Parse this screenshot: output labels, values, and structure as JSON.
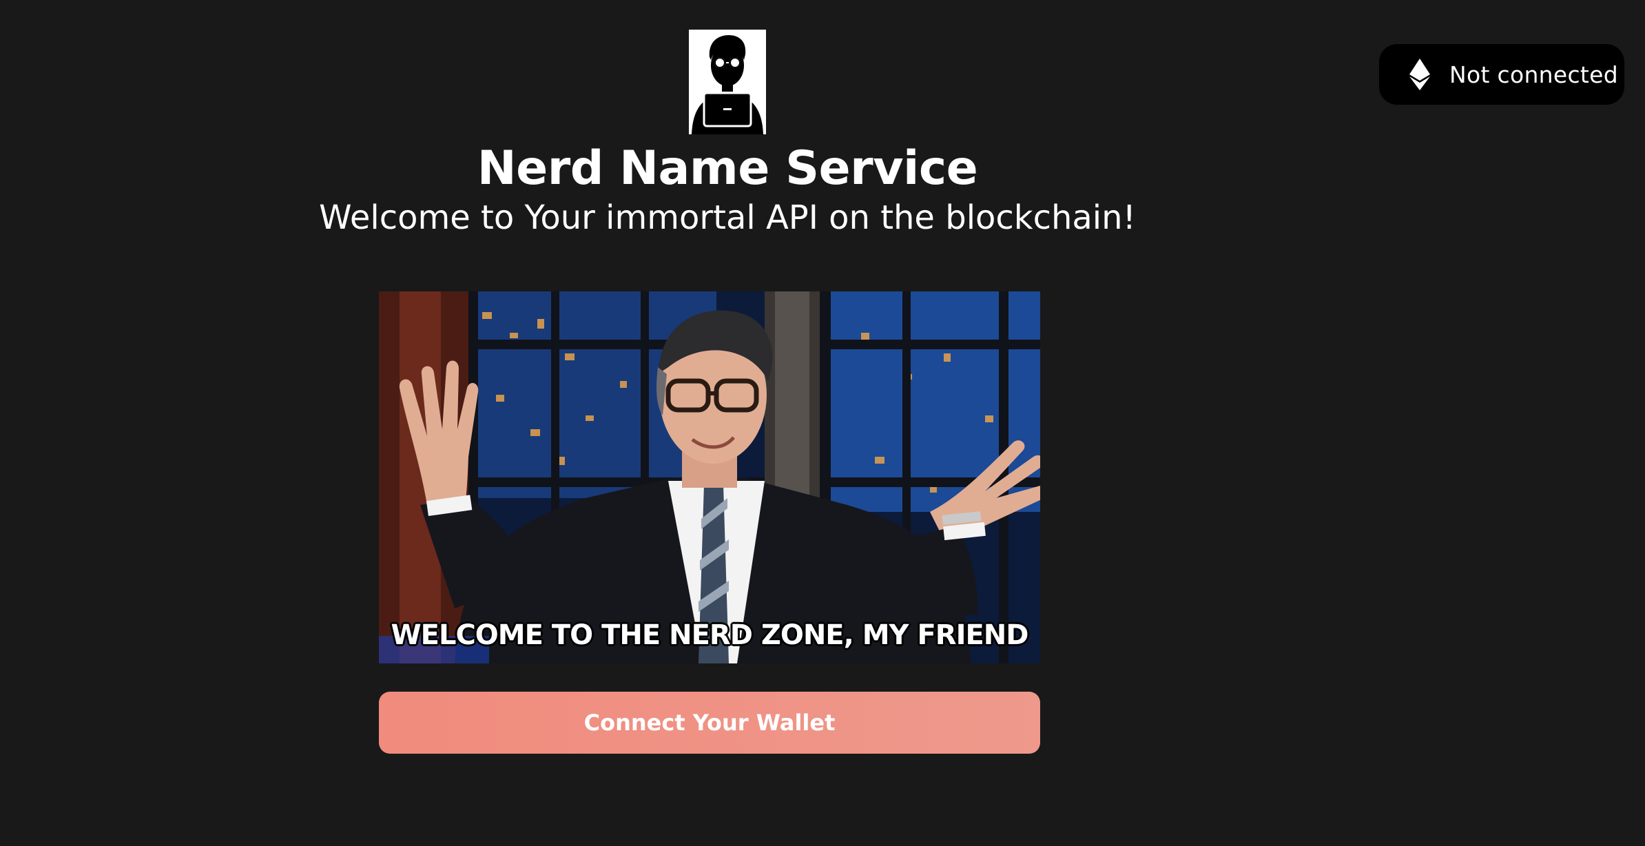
{
  "network": {
    "icon": "ethereum-icon",
    "status_label": "Not connected"
  },
  "header": {
    "logo_icon": "nerd-avatar-icon",
    "title": "Nerd Name Service",
    "subtitle": "Welcome to Your immortal API on the blockchain!"
  },
  "hero": {
    "caption": "WELCOME TO THE NERD ZONE, MY FRIEND"
  },
  "cta": {
    "label": "Connect Your Wallet"
  },
  "colors": {
    "background": "#191919",
    "pill_background": "#000000",
    "button_gradient_start": "#f08b7d",
    "button_gradient_end": "#ee998c",
    "text": "#ffffff"
  }
}
